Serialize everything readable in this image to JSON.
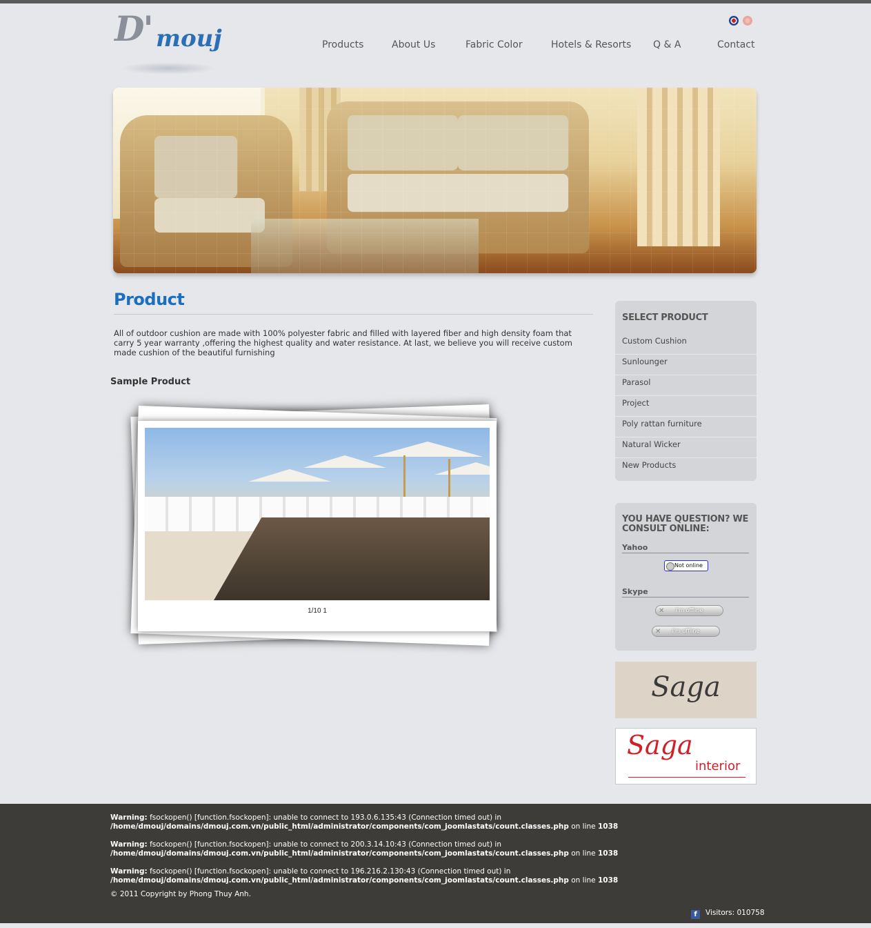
{
  "header": {
    "logo": {
      "script_text": "D'",
      "mouj_text": "mouj"
    },
    "nav": [
      {
        "label": "Products"
      },
      {
        "label": "About Us"
      },
      {
        "label": "Fabric Color"
      },
      {
        "label": "Hotels & Resorts"
      },
      {
        "label": "Q & A"
      },
      {
        "label": "Contact"
      }
    ],
    "languages": [
      "english-flag-icon",
      "vietnamese-flag-icon"
    ]
  },
  "main": {
    "title": "Product",
    "intro": "All of outdoor cushion are made with 100% polyester fabric and filled with layered fiber and high density foam that carry 5 year warranty ,offering the highest quality and water resistance. At last, we believe you will receive custom made cushion of the beautiful furnishing",
    "sample_title": "Sample Product",
    "gallery_counter": "1/10 1"
  },
  "sidebar": {
    "products_title": "SELECT PRODUCT",
    "products": [
      "Custom Cushion",
      "Sunlounger",
      "Parasol",
      "Project",
      "Poly rattan furniture",
      "Natural Wicker",
      "New Products"
    ],
    "support_title": "YOU HAVE QUESTION? WE CONSULT ONLINE:",
    "yahoo_label": "Yahoo",
    "yahoo_status": "Not online",
    "skype_label": "Skype",
    "skype_status_1": "I'm offline",
    "skype_status_2": "I'm offline",
    "ad1_text": "Saga",
    "ad2_text": "Saga",
    "ad2_sub": "interior"
  },
  "footer": {
    "warnings": [
      {
        "label": "Warning:",
        "text": " fsockopen() [function.fsockopen]: unable to connect to 193.0.6.135:43 (Connection timed out) in ",
        "path": "/home/dmouj/domains/dmouj.com.vn/public_html/administrator/components/com_joomlastats/count.classes.php",
        "online": " on line ",
        "line": "1038"
      },
      {
        "label": "Warning:",
        "text": " fsockopen() [function.fsockopen]: unable to connect to 200.3.14.10:43 (Connection timed out) in ",
        "path": "/home/dmouj/domains/dmouj.com.vn/public_html/administrator/components/com_joomlastats/count.classes.php",
        "online": " on line ",
        "line": "1038"
      },
      {
        "label": "Warning:",
        "text": " fsockopen() [function.fsockopen]: unable to connect to 196.216.2.130:43 (Connection timed out) in ",
        "path": "/home/dmouj/domains/dmouj.com.vn/public_html/administrator/components/com_joomlastats/count.classes.php",
        "online": " on line ",
        "line": "1038"
      }
    ],
    "copyright": "© 2011 Copyright by Phong Thuy Anh.",
    "visitors": "Visitors: 010758"
  },
  "colors": {
    "accent": "#1a6fc0",
    "footer_bg": "#3d3c39",
    "page_bg": "#e6e7ea"
  }
}
